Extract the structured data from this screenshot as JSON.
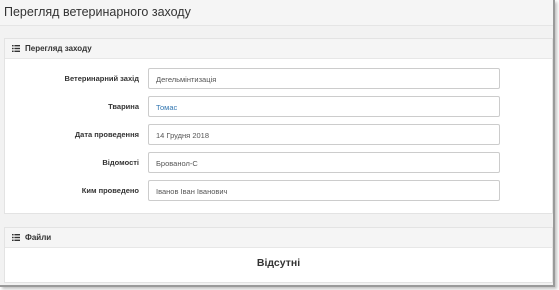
{
  "page": {
    "title": "Перегляд ветеринарного заходу"
  },
  "details_panel": {
    "heading": "Перегляд заходу",
    "icon": "list-icon",
    "fields": [
      {
        "label": "Ветеринарний захід",
        "value": "Дегельмінтизація"
      },
      {
        "label": "Тварина",
        "value": "Томас"
      },
      {
        "label": "Дата проведення",
        "value": "14 Грудня 2018"
      },
      {
        "label": "Відомості",
        "value": "Брованол-С"
      },
      {
        "label": "Ким проведено",
        "value": "Іванов Іван Іванович"
      }
    ]
  },
  "files_panel": {
    "heading": "Файли",
    "icon": "list-icon",
    "empty_text": "Відсутні"
  },
  "colors": {
    "link": "#3276b1",
    "text": "#333333",
    "panel_heading_bg": "#f5f5f5"
  }
}
